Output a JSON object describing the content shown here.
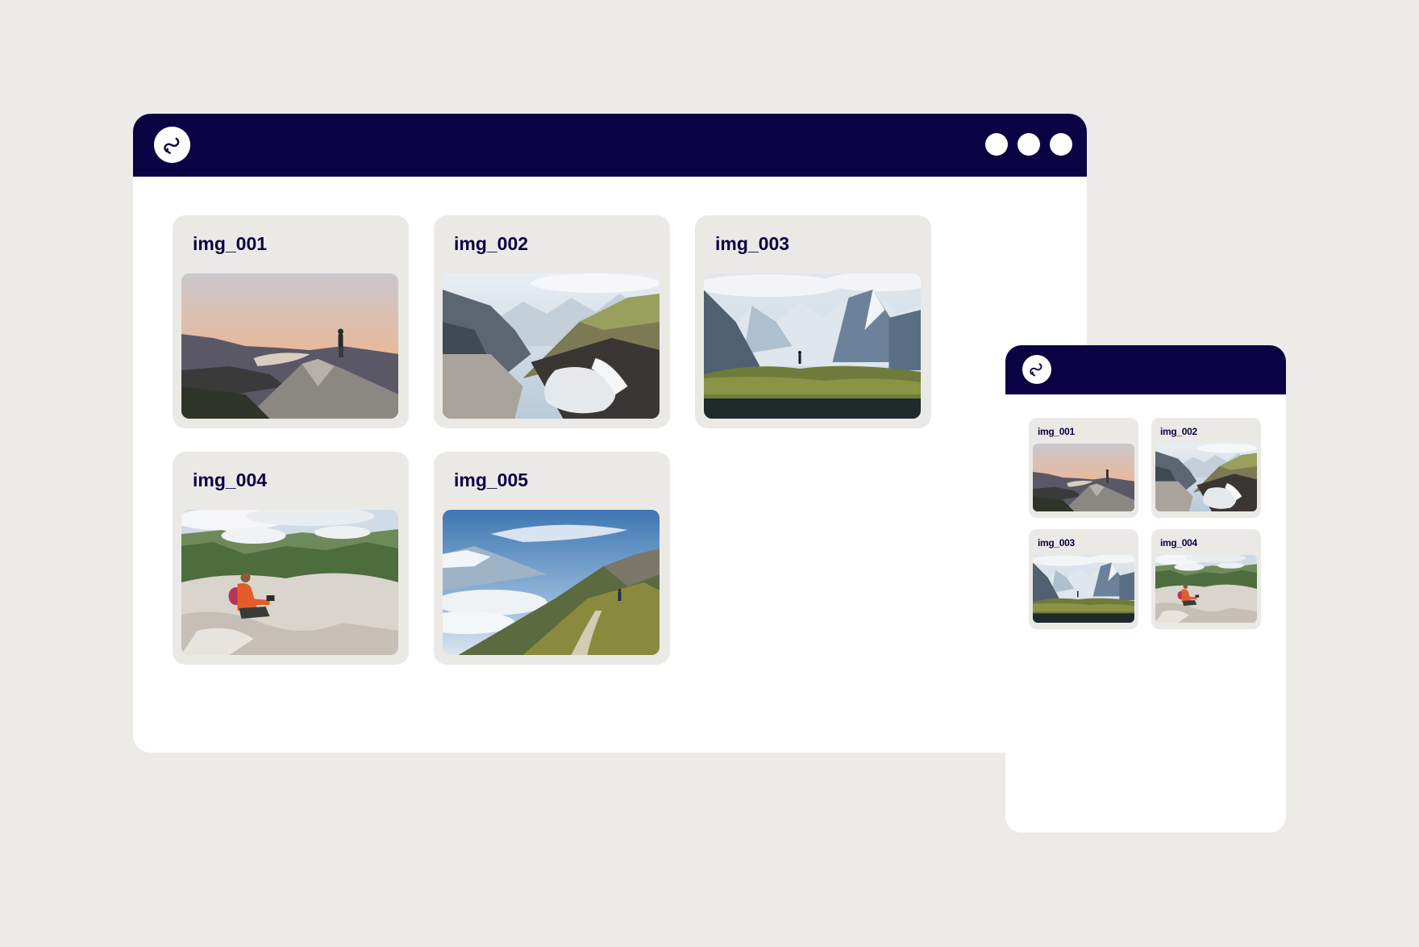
{
  "colors": {
    "background": "#ecebe8",
    "titlebar": "#0b0244",
    "card": "#ebe9e6",
    "label": "#0b0244"
  },
  "desktop": {
    "logo_icon": "app-logo-icon",
    "window_controls": [
      "dot",
      "dot",
      "dot"
    ],
    "cards": [
      {
        "label": "img_001",
        "image": "sunset-summit-lake"
      },
      {
        "label": "img_002",
        "image": "mountain-waterfall"
      },
      {
        "label": "img_003",
        "image": "snowy-peaks-hiker"
      },
      {
        "label": "img_004",
        "image": "hiker-sitting-rocks"
      },
      {
        "label": "img_005",
        "image": "mountain-trail-clouds"
      }
    ]
  },
  "mobile": {
    "logo_icon": "app-logo-icon",
    "cards": [
      {
        "label": "img_001",
        "image": "sunset-summit-lake"
      },
      {
        "label": "img_002",
        "image": "mountain-waterfall"
      },
      {
        "label": "img_003",
        "image": "snowy-peaks-hiker"
      },
      {
        "label": "img_004",
        "image": "hiker-sitting-rocks"
      }
    ]
  }
}
